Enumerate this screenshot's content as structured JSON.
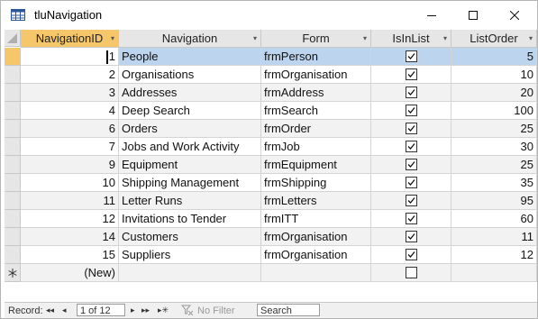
{
  "window": {
    "title": "tluNavigation",
    "min_glyph": "─",
    "max_glyph": "☐",
    "close_glyph": "✕"
  },
  "columns": [
    {
      "label": "NavigationID",
      "dropdown": "▾"
    },
    {
      "label": "Navigation",
      "dropdown": "▾"
    },
    {
      "label": "Form",
      "dropdown": "▾"
    },
    {
      "label": "IsInList",
      "dropdown": "▾"
    },
    {
      "label": "ListOrder",
      "dropdown": "▾"
    }
  ],
  "rows": [
    {
      "id": "1",
      "navigation": "People",
      "form": "frmPerson",
      "isinlist": true,
      "listorder": "5"
    },
    {
      "id": "2",
      "navigation": "Organisations",
      "form": "frmOrganisation",
      "isinlist": true,
      "listorder": "10"
    },
    {
      "id": "3",
      "navigation": "Addresses",
      "form": "frmAddress",
      "isinlist": true,
      "listorder": "20"
    },
    {
      "id": "4",
      "navigation": "Deep Search",
      "form": "frmSearch",
      "isinlist": true,
      "listorder": "100"
    },
    {
      "id": "6",
      "navigation": "Orders",
      "form": "frmOrder",
      "isinlist": true,
      "listorder": "25"
    },
    {
      "id": "7",
      "navigation": "Jobs and Work Activity",
      "form": "frmJob",
      "isinlist": true,
      "listorder": "30"
    },
    {
      "id": "9",
      "navigation": "Equipment",
      "form": "frmEquipment",
      "isinlist": true,
      "listorder": "25"
    },
    {
      "id": "10",
      "navigation": "Shipping Management",
      "form": "frmShipping",
      "isinlist": true,
      "listorder": "35"
    },
    {
      "id": "11",
      "navigation": "Letter Runs",
      "form": "frmLetters",
      "isinlist": true,
      "listorder": "95"
    },
    {
      "id": "12",
      "navigation": "Invitations to Tender",
      "form": "frmITT",
      "isinlist": true,
      "listorder": "60"
    },
    {
      "id": "14",
      "navigation": "Customers",
      "form": "frmOrganisation",
      "isinlist": true,
      "listorder": "11"
    },
    {
      "id": "15",
      "navigation": "Suppliers",
      "form": "frmOrganisation",
      "isinlist": true,
      "listorder": "12"
    }
  ],
  "new_row": {
    "id": "(New)",
    "isinlist": false
  },
  "status": {
    "record_label": "Record:",
    "position": "1 of 12",
    "no_filter": "No Filter",
    "search": "Search",
    "first": "◂◂",
    "prev": "◂",
    "next": "▸",
    "last": "▸▸",
    "new": "▸✳"
  },
  "colors": {
    "selected_header": "#f5c76a",
    "current_row": "#bcd4ee",
    "alt_row": "#f2f2f2"
  }
}
